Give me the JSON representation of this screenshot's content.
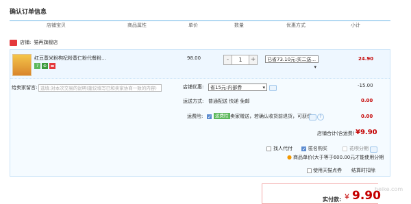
{
  "page": {
    "title": "确认订单信息"
  },
  "columns": [
    "店铺宝贝",
    "商品属性",
    "单价",
    "数量",
    "优惠方式",
    "小计"
  ],
  "store": {
    "prefix": "店铺:",
    "name": "猫再旗舰店"
  },
  "item": {
    "name": "红豆薏米粉枸杞粉薏仁粉代餐粉...",
    "badges": [
      {
        "text": "7",
        "color": "#5cb85c",
        "icon": "seven-day-return-icon"
      },
      {
        "text": "⊕",
        "color": "#3c9b3c",
        "icon": "guarantee-icon"
      },
      {
        "text": "▬",
        "color": "#e4393c",
        "icon": "flag-icon"
      }
    ],
    "unit_price": "98.00",
    "quantity": "1",
    "qty_minus": "-",
    "qty_plus": "+",
    "discount_option": "已省73.10元:买二送...",
    "subtotal": "24.90"
  },
  "message": {
    "label": "给卖家留言:",
    "placeholder": "选填:对本次交易的说明(建议填写已和卖家协商一致的内容)"
  },
  "store_discount": {
    "label": "店铺优惠:",
    "option": "省15元:内部券",
    "value": "-15.00"
  },
  "shipping": {
    "label": "运送方式:",
    "text": "普通配送 快递 免邮",
    "value": "0.00"
  },
  "insurance": {
    "label": "运费险:",
    "tag": "运费险",
    "text": "卖家赠送，若确认收货前退货，可获保...",
    "value": "0.00"
  },
  "store_total": {
    "label": "店铺合计(含运费)",
    "value": "¥9.90"
  },
  "options": {
    "find_friend": {
      "label": "找人代付",
      "checked": false
    },
    "anonymous": {
      "label": "匿名购买",
      "checked": true
    },
    "huabei": {
      "label": "花呗分期",
      "checked": false
    },
    "huabei_note": "商品单价(大于等于600.00元才能使用分期"
  },
  "tmall_points": {
    "label": "使用天猫点券",
    "checked": false
  },
  "installment_label": "结算时扣除",
  "pay": {
    "label": "实付款:",
    "currency": "¥",
    "amount": "9.90"
  },
  "watermark": "heike.com"
}
